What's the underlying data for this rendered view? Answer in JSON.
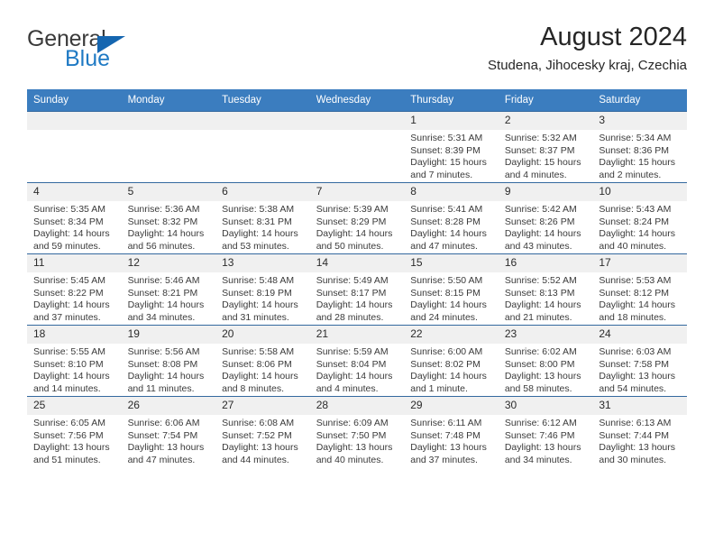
{
  "brand": {
    "name_top": "General",
    "name_bottom": "Blue",
    "accent_color": "#1566b0"
  },
  "header": {
    "title": "August 2024",
    "subtitle": "Studena, Jihocesky kraj, Czechia"
  },
  "calendar": {
    "header_bg": "#3b7dbf",
    "daynum_bg": "#f0f0f0",
    "weekday_headers": [
      "Sunday",
      "Monday",
      "Tuesday",
      "Wednesday",
      "Thursday",
      "Friday",
      "Saturday"
    ],
    "weeks": [
      [
        {
          "day": "",
          "sunrise": "",
          "sunset": "",
          "daylight_1": "",
          "daylight_2": ""
        },
        {
          "day": "",
          "sunrise": "",
          "sunset": "",
          "daylight_1": "",
          "daylight_2": ""
        },
        {
          "day": "",
          "sunrise": "",
          "sunset": "",
          "daylight_1": "",
          "daylight_2": ""
        },
        {
          "day": "",
          "sunrise": "",
          "sunset": "",
          "daylight_1": "",
          "daylight_2": ""
        },
        {
          "day": "1",
          "sunrise": "Sunrise: 5:31 AM",
          "sunset": "Sunset: 8:39 PM",
          "daylight_1": "Daylight: 15 hours",
          "daylight_2": "and 7 minutes."
        },
        {
          "day": "2",
          "sunrise": "Sunrise: 5:32 AM",
          "sunset": "Sunset: 8:37 PM",
          "daylight_1": "Daylight: 15 hours",
          "daylight_2": "and 4 minutes."
        },
        {
          "day": "3",
          "sunrise": "Sunrise: 5:34 AM",
          "sunset": "Sunset: 8:36 PM",
          "daylight_1": "Daylight: 15 hours",
          "daylight_2": "and 2 minutes."
        }
      ],
      [
        {
          "day": "4",
          "sunrise": "Sunrise: 5:35 AM",
          "sunset": "Sunset: 8:34 PM",
          "daylight_1": "Daylight: 14 hours",
          "daylight_2": "and 59 minutes."
        },
        {
          "day": "5",
          "sunrise": "Sunrise: 5:36 AM",
          "sunset": "Sunset: 8:32 PM",
          "daylight_1": "Daylight: 14 hours",
          "daylight_2": "and 56 minutes."
        },
        {
          "day": "6",
          "sunrise": "Sunrise: 5:38 AM",
          "sunset": "Sunset: 8:31 PM",
          "daylight_1": "Daylight: 14 hours",
          "daylight_2": "and 53 minutes."
        },
        {
          "day": "7",
          "sunrise": "Sunrise: 5:39 AM",
          "sunset": "Sunset: 8:29 PM",
          "daylight_1": "Daylight: 14 hours",
          "daylight_2": "and 50 minutes."
        },
        {
          "day": "8",
          "sunrise": "Sunrise: 5:41 AM",
          "sunset": "Sunset: 8:28 PM",
          "daylight_1": "Daylight: 14 hours",
          "daylight_2": "and 47 minutes."
        },
        {
          "day": "9",
          "sunrise": "Sunrise: 5:42 AM",
          "sunset": "Sunset: 8:26 PM",
          "daylight_1": "Daylight: 14 hours",
          "daylight_2": "and 43 minutes."
        },
        {
          "day": "10",
          "sunrise": "Sunrise: 5:43 AM",
          "sunset": "Sunset: 8:24 PM",
          "daylight_1": "Daylight: 14 hours",
          "daylight_2": "and 40 minutes."
        }
      ],
      [
        {
          "day": "11",
          "sunrise": "Sunrise: 5:45 AM",
          "sunset": "Sunset: 8:22 PM",
          "daylight_1": "Daylight: 14 hours",
          "daylight_2": "and 37 minutes."
        },
        {
          "day": "12",
          "sunrise": "Sunrise: 5:46 AM",
          "sunset": "Sunset: 8:21 PM",
          "daylight_1": "Daylight: 14 hours",
          "daylight_2": "and 34 minutes."
        },
        {
          "day": "13",
          "sunrise": "Sunrise: 5:48 AM",
          "sunset": "Sunset: 8:19 PM",
          "daylight_1": "Daylight: 14 hours",
          "daylight_2": "and 31 minutes."
        },
        {
          "day": "14",
          "sunrise": "Sunrise: 5:49 AM",
          "sunset": "Sunset: 8:17 PM",
          "daylight_1": "Daylight: 14 hours",
          "daylight_2": "and 28 minutes."
        },
        {
          "day": "15",
          "sunrise": "Sunrise: 5:50 AM",
          "sunset": "Sunset: 8:15 PM",
          "daylight_1": "Daylight: 14 hours",
          "daylight_2": "and 24 minutes."
        },
        {
          "day": "16",
          "sunrise": "Sunrise: 5:52 AM",
          "sunset": "Sunset: 8:13 PM",
          "daylight_1": "Daylight: 14 hours",
          "daylight_2": "and 21 minutes."
        },
        {
          "day": "17",
          "sunrise": "Sunrise: 5:53 AM",
          "sunset": "Sunset: 8:12 PM",
          "daylight_1": "Daylight: 14 hours",
          "daylight_2": "and 18 minutes."
        }
      ],
      [
        {
          "day": "18",
          "sunrise": "Sunrise: 5:55 AM",
          "sunset": "Sunset: 8:10 PM",
          "daylight_1": "Daylight: 14 hours",
          "daylight_2": "and 14 minutes."
        },
        {
          "day": "19",
          "sunrise": "Sunrise: 5:56 AM",
          "sunset": "Sunset: 8:08 PM",
          "daylight_1": "Daylight: 14 hours",
          "daylight_2": "and 11 minutes."
        },
        {
          "day": "20",
          "sunrise": "Sunrise: 5:58 AM",
          "sunset": "Sunset: 8:06 PM",
          "daylight_1": "Daylight: 14 hours",
          "daylight_2": "and 8 minutes."
        },
        {
          "day": "21",
          "sunrise": "Sunrise: 5:59 AM",
          "sunset": "Sunset: 8:04 PM",
          "daylight_1": "Daylight: 14 hours",
          "daylight_2": "and 4 minutes."
        },
        {
          "day": "22",
          "sunrise": "Sunrise: 6:00 AM",
          "sunset": "Sunset: 8:02 PM",
          "daylight_1": "Daylight: 14 hours",
          "daylight_2": "and 1 minute."
        },
        {
          "day": "23",
          "sunrise": "Sunrise: 6:02 AM",
          "sunset": "Sunset: 8:00 PM",
          "daylight_1": "Daylight: 13 hours",
          "daylight_2": "and 58 minutes."
        },
        {
          "day": "24",
          "sunrise": "Sunrise: 6:03 AM",
          "sunset": "Sunset: 7:58 PM",
          "daylight_1": "Daylight: 13 hours",
          "daylight_2": "and 54 minutes."
        }
      ],
      [
        {
          "day": "25",
          "sunrise": "Sunrise: 6:05 AM",
          "sunset": "Sunset: 7:56 PM",
          "daylight_1": "Daylight: 13 hours",
          "daylight_2": "and 51 minutes."
        },
        {
          "day": "26",
          "sunrise": "Sunrise: 6:06 AM",
          "sunset": "Sunset: 7:54 PM",
          "daylight_1": "Daylight: 13 hours",
          "daylight_2": "and 47 minutes."
        },
        {
          "day": "27",
          "sunrise": "Sunrise: 6:08 AM",
          "sunset": "Sunset: 7:52 PM",
          "daylight_1": "Daylight: 13 hours",
          "daylight_2": "and 44 minutes."
        },
        {
          "day": "28",
          "sunrise": "Sunrise: 6:09 AM",
          "sunset": "Sunset: 7:50 PM",
          "daylight_1": "Daylight: 13 hours",
          "daylight_2": "and 40 minutes."
        },
        {
          "day": "29",
          "sunrise": "Sunrise: 6:11 AM",
          "sunset": "Sunset: 7:48 PM",
          "daylight_1": "Daylight: 13 hours",
          "daylight_2": "and 37 minutes."
        },
        {
          "day": "30",
          "sunrise": "Sunrise: 6:12 AM",
          "sunset": "Sunset: 7:46 PM",
          "daylight_1": "Daylight: 13 hours",
          "daylight_2": "and 34 minutes."
        },
        {
          "day": "31",
          "sunrise": "Sunrise: 6:13 AM",
          "sunset": "Sunset: 7:44 PM",
          "daylight_1": "Daylight: 13 hours",
          "daylight_2": "and 30 minutes."
        }
      ]
    ]
  }
}
